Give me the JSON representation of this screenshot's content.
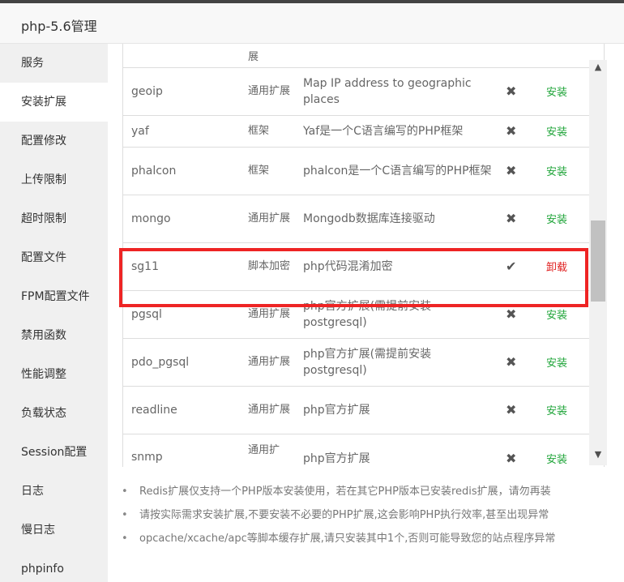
{
  "window": {
    "title": "php-5.6管理"
  },
  "sidebar": {
    "items": [
      {
        "label": "服务"
      },
      {
        "label": "安装扩展"
      },
      {
        "label": "配置修改"
      },
      {
        "label": "上传限制"
      },
      {
        "label": "超时限制"
      },
      {
        "label": "配置文件"
      },
      {
        "label": "FPM配置文件"
      },
      {
        "label": "禁用函数"
      },
      {
        "label": "性能调整"
      },
      {
        "label": "负载状态"
      },
      {
        "label": "Session配置"
      },
      {
        "label": "日志"
      },
      {
        "label": "慢日志"
      },
      {
        "label": "phpinfo"
      }
    ],
    "active_index": 1
  },
  "extensions": {
    "rows": [
      {
        "name": "",
        "type": "展",
        "desc": "",
        "status": "",
        "action": ""
      },
      {
        "name": "geoip",
        "type": "通用扩展",
        "desc": "Map IP address to geographic places",
        "status": "✖",
        "action": "安装"
      },
      {
        "name": "yaf",
        "type": "框架",
        "desc": "Yaf是一个C语言编写的PHP框架",
        "status": "✖",
        "action": "安装"
      },
      {
        "name": "phalcon",
        "type": "框架",
        "desc": "phalcon是一个C语言编写的PHP框架",
        "status": "✖",
        "action": "安装"
      },
      {
        "name": "mongo",
        "type": "通用扩展",
        "desc": "Mongodb数据库连接驱动",
        "status": "✖",
        "action": "安装"
      },
      {
        "name": "sg11",
        "type": "脚本加密",
        "desc": "php代码混淆加密",
        "status": "✔",
        "action": "卸载"
      },
      {
        "name": "pgsql",
        "type": "通用扩展",
        "desc": "php官方扩展(需提前安装postgresql)",
        "status": "✖",
        "action": "安装"
      },
      {
        "name": "pdo_pgsql",
        "type": "通用扩展",
        "desc": "php官方扩展(需提前安装postgresql)",
        "status": "✖",
        "action": "安装"
      },
      {
        "name": "readline",
        "type": "通用扩展",
        "desc": "php官方扩展",
        "status": "✖",
        "action": "安装"
      },
      {
        "name": "snmp",
        "type": "通用扩",
        "desc": "php官方扩展",
        "status": "✖",
        "action": "安装"
      }
    ]
  },
  "scrollbar": {
    "up": "▲",
    "down": "▼"
  },
  "notes": [
    "Redis扩展仅支持一个PHP版本安装使用，若在其它PHP版本已安装redis扩展，请勿再装",
    "请按实际需求安装扩展,不要安装不必要的PHP扩展,这会影响PHP执行效率,甚至出现异常",
    "opcache/xcache/apc等脚本缓存扩展,请只安装其中1个,否则可能导致您的站点程序异常"
  ],
  "notes_bullet": "•",
  "colors": {
    "install": "#20a53a",
    "uninstall": "#e02020",
    "highlight": "#ee2424",
    "sidebar_bg": "#f0f0f0"
  }
}
